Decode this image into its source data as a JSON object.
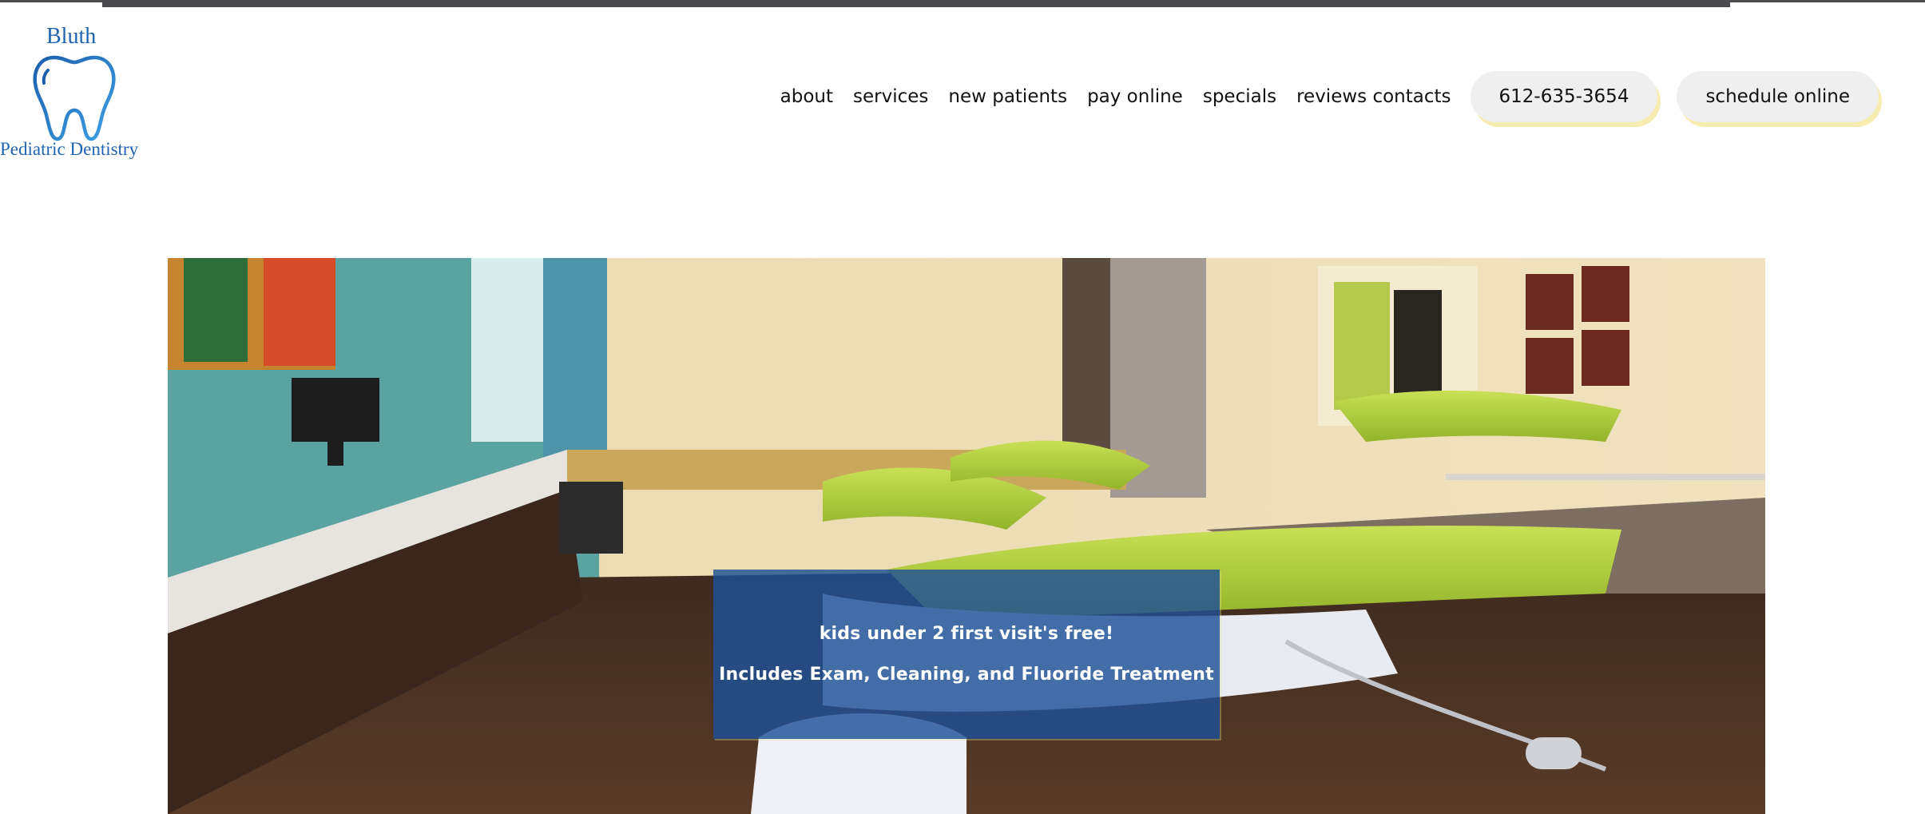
{
  "logo": {
    "brand": "Bluth",
    "subtitle": "Pediatric Dentistry",
    "icon": "tooth-icon",
    "color": "#1f63b2"
  },
  "nav": {
    "links": [
      "about",
      "services",
      "new patients",
      "pay online",
      "specials",
      "reviews contacts"
    ],
    "phone": "612-635-3654",
    "schedule": "schedule online"
  },
  "hero": {
    "image": "dental-office-photo",
    "promo_line1": "kids under 2 first visit's free!",
    "promo_line2": "Includes Exam, Cleaning, and Fluoride Treatment",
    "promo_color": "#1e5096"
  }
}
